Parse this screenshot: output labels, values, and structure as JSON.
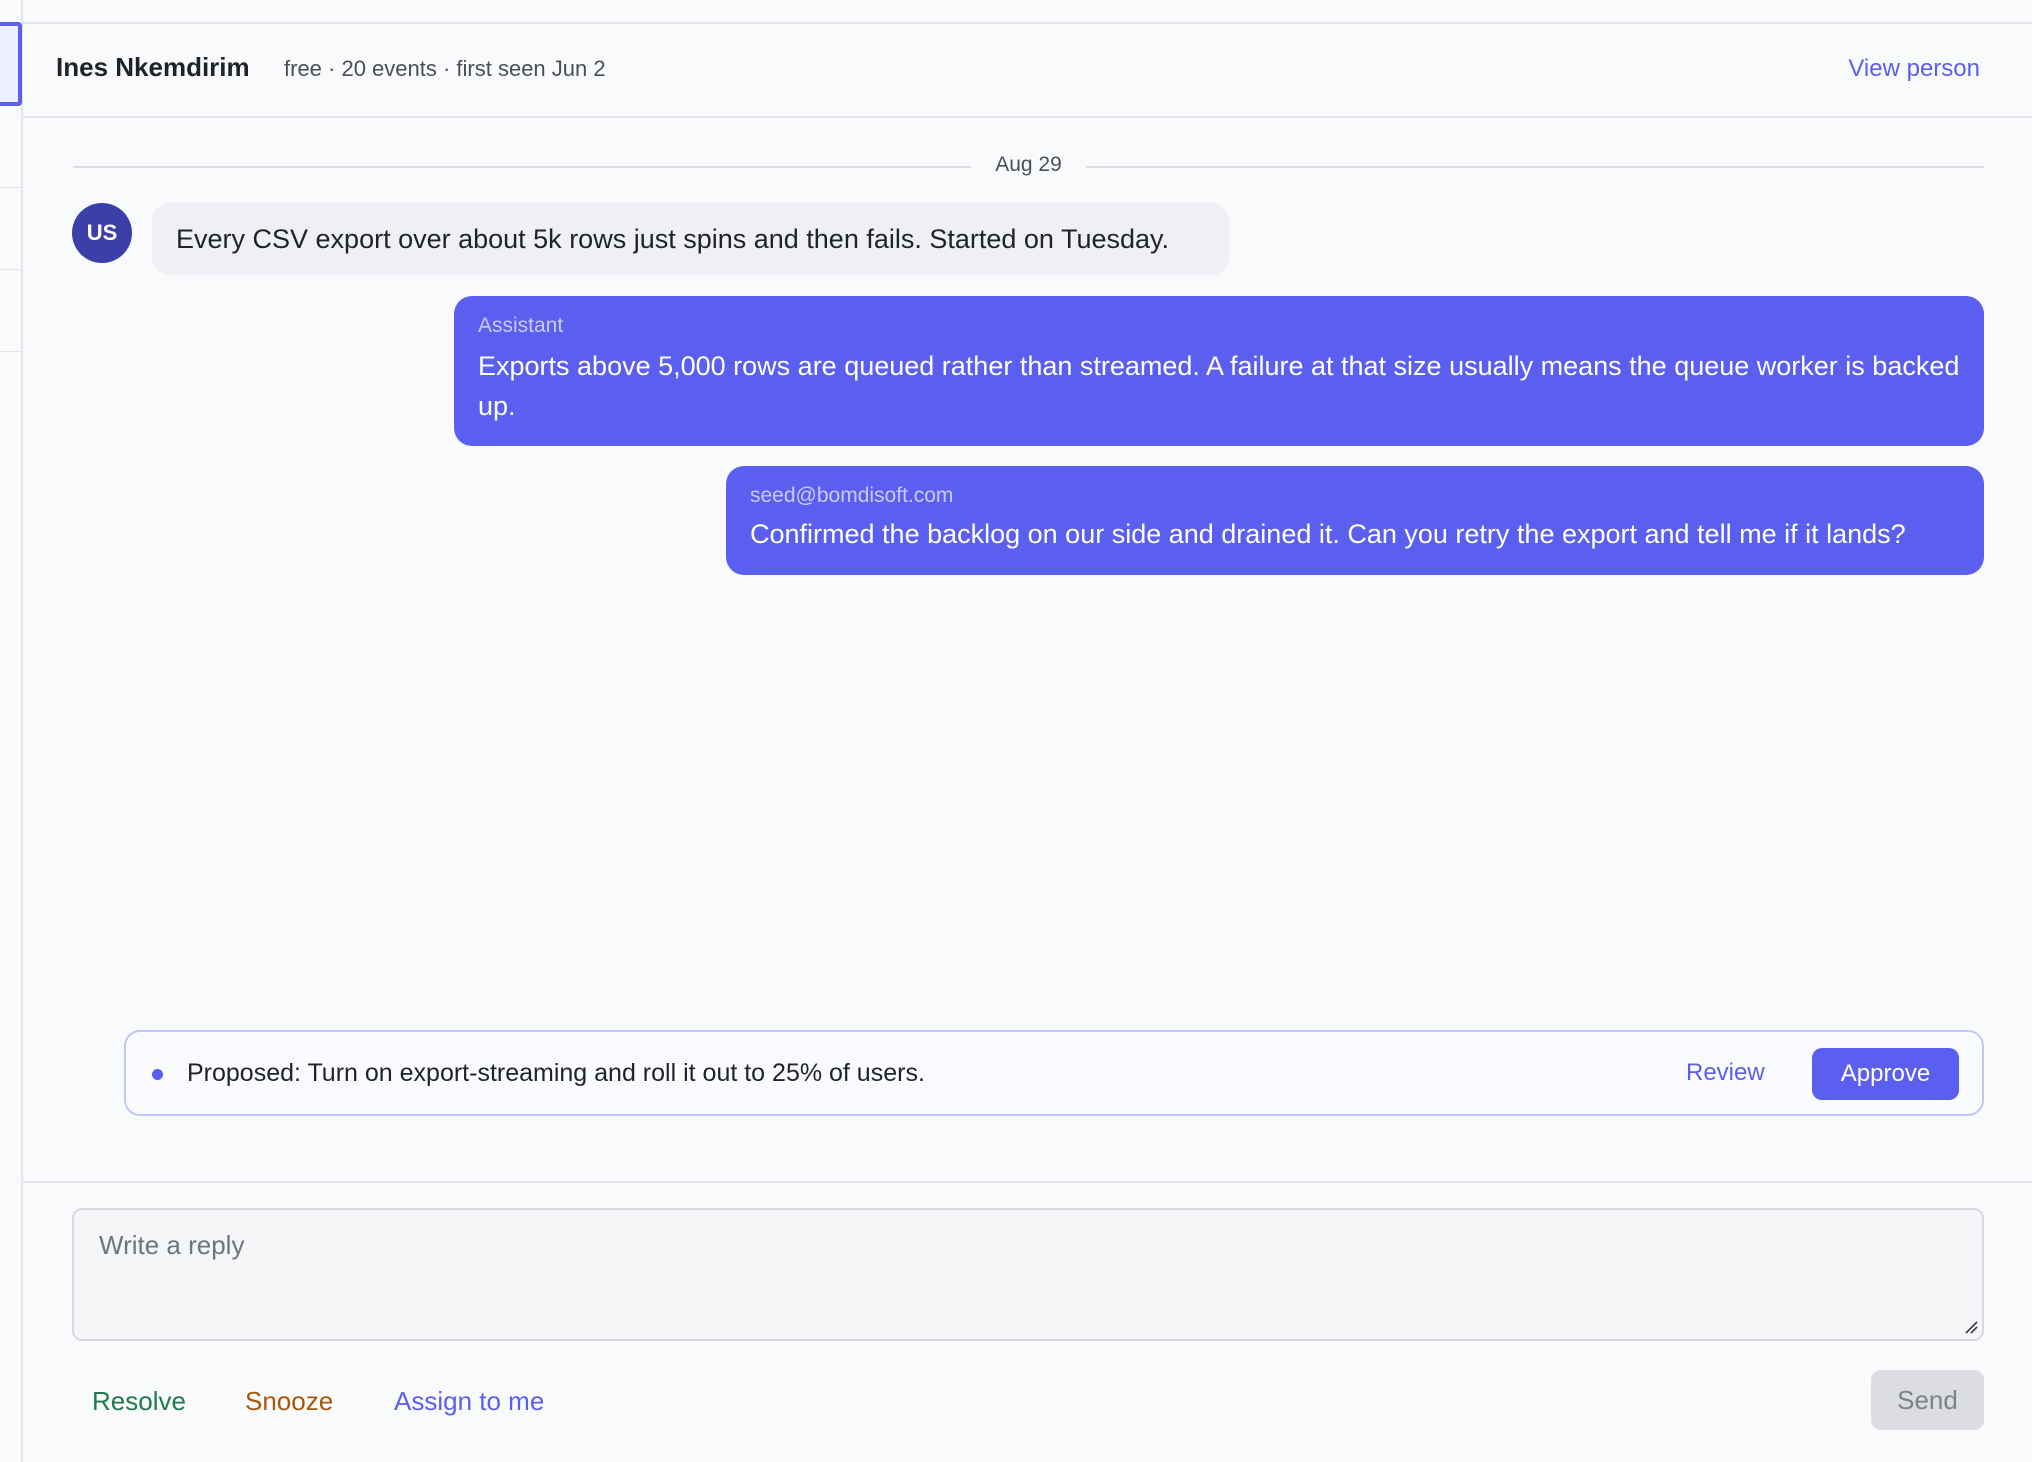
{
  "header": {
    "person_name": "Ines Nkemdirim",
    "person_meta": "free · 20 events · first seen Jun 2",
    "view_person_label": "View person"
  },
  "thread": {
    "date_label": "Aug 29",
    "messages": [
      {
        "avatar_initials": "US",
        "text": "Every CSV export over about 5k rows just spins and then fails. Started on Tuesday."
      },
      {
        "sender": "Assistant",
        "text": "Exports above 5,000 rows are queued rather than streamed. A failure at that size usually means the queue worker is backed up."
      },
      {
        "sender": "seed@bomdisoft.com",
        "text": "Confirmed the backlog on our side and drained it. Can you retry the export and tell me if it lands?"
      }
    ]
  },
  "proposal": {
    "text": "Proposed: Turn on export-streaming and roll it out to 25% of users.",
    "review_label": "Review",
    "approve_label": "Approve"
  },
  "composer": {
    "placeholder": "Write a reply",
    "value": "",
    "resolve_label": "Resolve",
    "snooze_label": "Snooze",
    "assign_label": "Assign to me",
    "send_label": "Send"
  },
  "colors": {
    "accent": "#5b5fef",
    "avatar_bg": "#3b3fa8",
    "resolve": "#1f7a4d",
    "snooze": "#a8570a",
    "user_bubble": "#eff0f3"
  },
  "icons": {
    "proposal_marker": "dot-icon",
    "textarea_grip": "resize-grip-icon"
  }
}
